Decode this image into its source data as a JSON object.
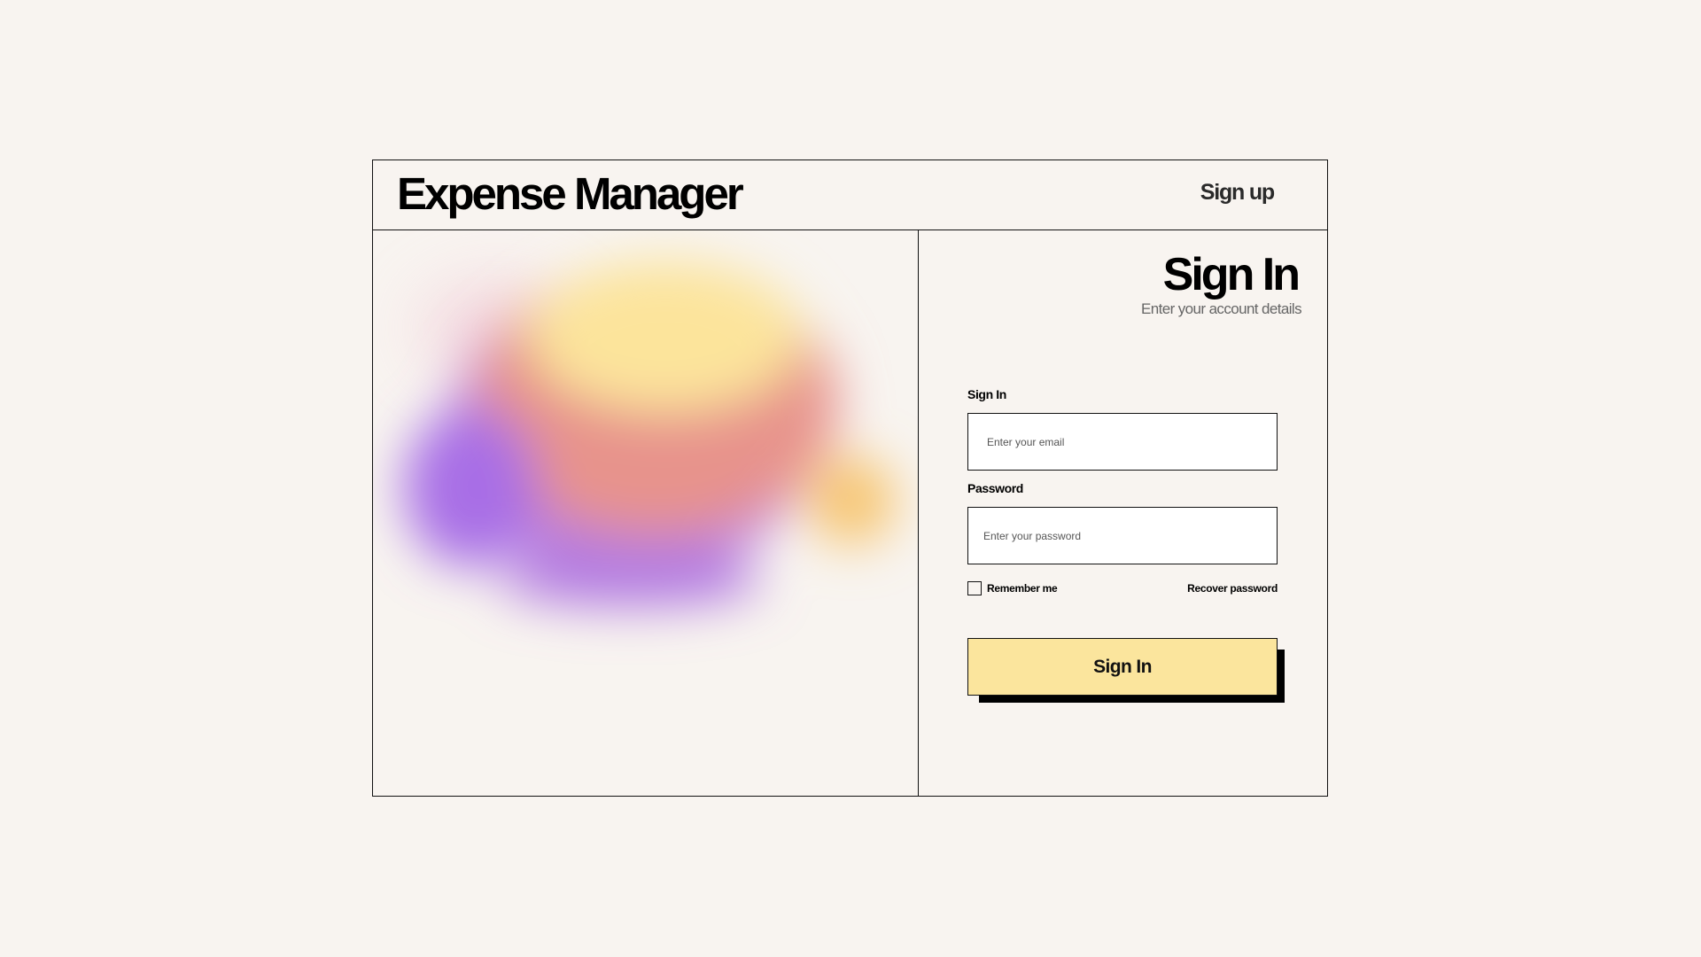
{
  "header": {
    "app_title": "Expense Manager",
    "signup_label": "Sign up"
  },
  "hero": {
    "colors": [
      "#fde89b",
      "#e88b85",
      "#b072e3",
      "#f8c870"
    ]
  },
  "form": {
    "title": "Sign In",
    "subtitle": "Enter your account details",
    "email_label": "Sign In",
    "email_placeholder": "Enter your email",
    "email_value": "",
    "password_label": "Password",
    "password_placeholder": "Enter your password",
    "password_value": "",
    "remember_label": "Remember me",
    "remember_checked": false,
    "recover_label": "Recover password",
    "submit_label": "Sign In"
  },
  "colors": {
    "background": "#f8f4f0",
    "button_fill": "#fbe59d",
    "border": "#111111",
    "subtitle_text": "#666666"
  }
}
